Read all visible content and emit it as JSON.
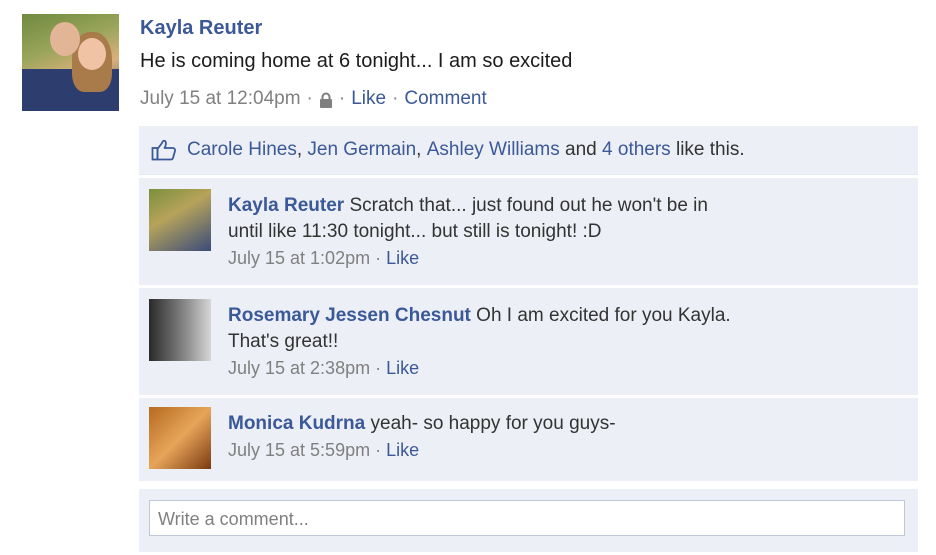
{
  "post": {
    "author": "Kayla Reuter",
    "message": "He is coming home at 6 tonight... I am so excited",
    "timestamp": "July 15 at 12:04pm",
    "separator": "·",
    "like_label": "Like",
    "comment_label": "Comment"
  },
  "likes": {
    "names": [
      "Carole Hines",
      "Jen Germain",
      "Ashley Williams"
    ],
    "and_text": "and",
    "others": "4 others",
    "suffix": "like this."
  },
  "comments": [
    {
      "author": "Kayla Reuter",
      "text_line1": "Scratch that... just found out he won't be in",
      "text_line2": "until like 11:30 tonight... but still is tonight! :D",
      "timestamp": "July 15 at 1:02pm",
      "like_label": "Like"
    },
    {
      "author": "Rosemary Jessen Chesnut",
      "text_line1": "Oh I am excited for you Kayla.",
      "text_line2": "That's great!!",
      "timestamp": "July 15 at 2:38pm",
      "like_label": "Like"
    },
    {
      "author": "Monica Kudrna",
      "text_line1": "yeah- so happy for you guys-",
      "timestamp": "July 15 at 5:59pm",
      "like_label": "Like"
    }
  ],
  "write_comment": {
    "placeholder": "Write a comment..."
  },
  "colors": {
    "link": "#3b5998",
    "feedback_bg": "#eceff5",
    "meta_gray": "#808080"
  },
  "icons": {
    "privacy": "lock-icon",
    "like": "thumbs-up-icon"
  }
}
